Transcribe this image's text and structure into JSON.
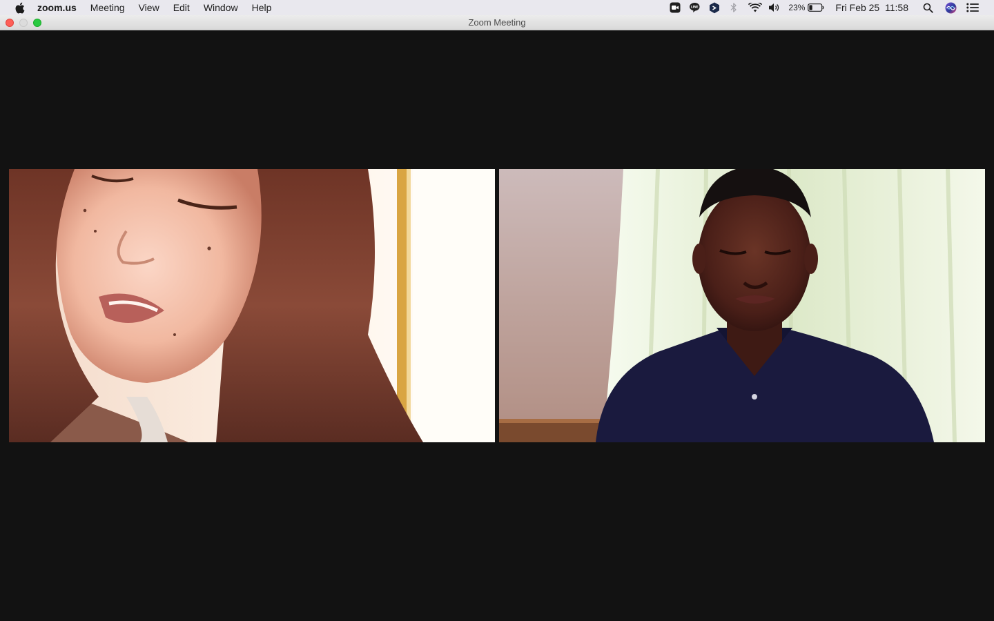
{
  "menubar": {
    "app_name": "zoom.us",
    "items": [
      "Meeting",
      "View",
      "Edit",
      "Window",
      "Help"
    ],
    "status": {
      "battery_percent": "23%",
      "datetime": "Fri Feb 25  11:58",
      "icons": [
        "zoom-status-icon",
        "line-icon",
        "app-shield-icon",
        "bluetooth-icon",
        "wifi-icon",
        "volume-icon",
        "battery-icon",
        "spotlight-search-icon",
        "siri-icon",
        "notification-center-icon"
      ]
    }
  },
  "window": {
    "title": "Zoom Meeting"
  },
  "participants": [
    {
      "tile": "left"
    },
    {
      "tile": "right"
    }
  ],
  "colors": {
    "background": "#121212",
    "menubar": "#e9e8ee",
    "close": "#fe5f57",
    "maximize": "#29c940"
  }
}
